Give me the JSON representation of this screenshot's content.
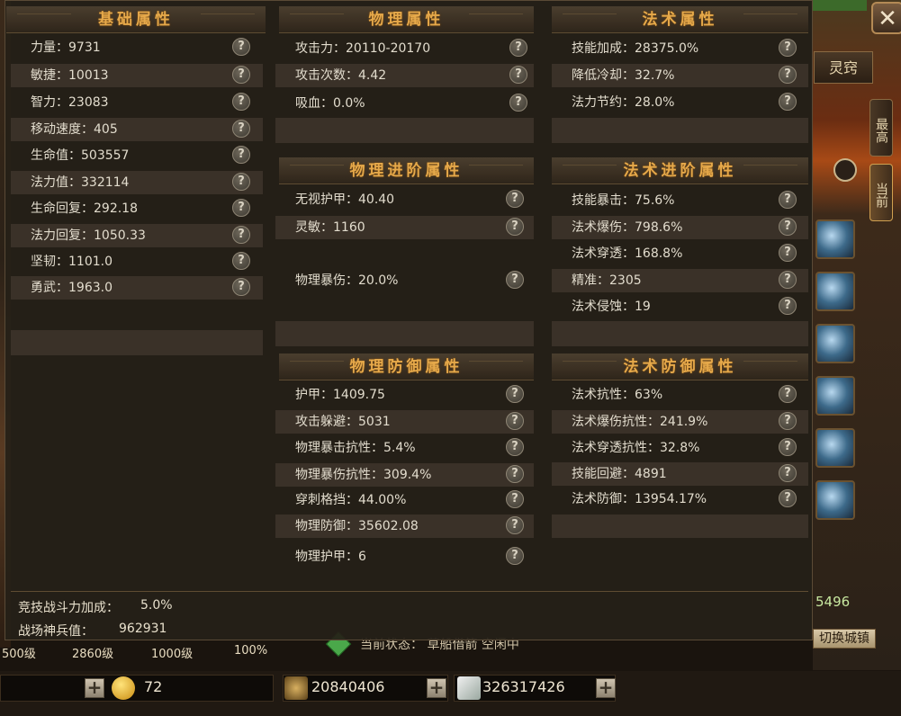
{
  "background": {
    "side_panel": {
      "lingqiao_tab": "灵窍",
      "vtab_highest": "最高",
      "vtab_current": "当前",
      "switch_city_button": "切换城镇",
      "partial_value": "5496"
    },
    "levels": [
      "500级",
      "2860级",
      "1000级",
      "100%"
    ],
    "status": "当前状态： 草船借箭 空闲中"
  },
  "resources": {
    "gold_value": "72",
    "res2_value": "20840406",
    "res3_value": "326317426"
  },
  "panel": {
    "basic": {
      "title": "基础属性",
      "rows": [
        "力量：9731",
        "敏捷：10013",
        "智力：23083",
        "移动速度：405",
        "生命值：503557",
        "法力值：332114",
        "生命回复：292.18",
        "法力回复：1050.33",
        "坚韧：1101.0",
        "勇武：1963.0"
      ]
    },
    "physical": {
      "title": "物理属性",
      "rows": [
        "攻击力：20110-20170",
        "攻击次数：4.42",
        "吸血：0.0%"
      ]
    },
    "magic": {
      "title": "法术属性",
      "rows": [
        "技能加成：28375.0%",
        "降低冷却：32.7%",
        "法力节约：28.0%"
      ]
    },
    "physical_adv": {
      "title": "物理进阶属性",
      "rows": [
        "无视护甲：40.40",
        "灵敏：1160",
        "物理暴伤：20.0%"
      ]
    },
    "magic_adv": {
      "title": "法术进阶属性",
      "rows": [
        "技能暴击：75.6%",
        "法术爆伤：798.6%",
        "法术穿透：168.8%",
        "精准：2305",
        "法术侵蚀：19"
      ]
    },
    "physical_def": {
      "title": "物理防御属性",
      "rows": [
        "护甲：1409.75",
        "攻击躲避：5031",
        "物理暴击抗性：5.4%",
        "物理暴伤抗性：309.4%",
        "穿刺格挡：44.00%",
        "物理防御：35602.08",
        "物理护甲：6"
      ]
    },
    "magic_def": {
      "title": "法术防御属性",
      "rows": [
        "法术抗性：63%",
        "法术爆伤抗性：241.9%",
        "法术穿透抗性：32.8%",
        "技能回避：4891",
        "法术防御：13954.17%"
      ]
    },
    "footer": {
      "arena_label": "竞技战斗力加成：",
      "arena_value": "5.0%",
      "weapon_label": "战场神兵值：",
      "weapon_value": "962931"
    },
    "help_glyph": "?"
  },
  "colors": {
    "title_gold": "#e6a94a",
    "panel_bg": "#262018",
    "row_shade": "#3a3128"
  },
  "icons": [
    "close-icon",
    "help-icon",
    "gold-coin-icon",
    "resource-icon",
    "diamond-icon",
    "plus-icon"
  ]
}
